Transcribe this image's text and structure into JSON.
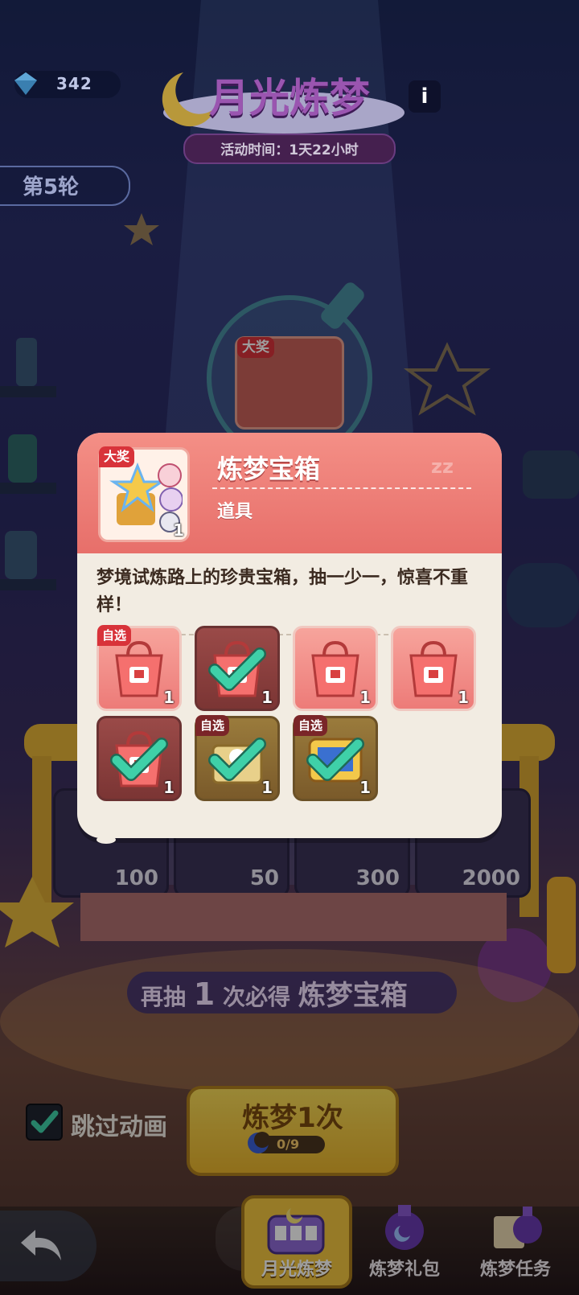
{
  "header": {
    "gem_count": "342",
    "title": "月光炼梦",
    "activity_time": "活动时间：1天22小时",
    "info_icon": "i",
    "round": "第5轮"
  },
  "board": {
    "prize_tag": "大奖",
    "reward_values": [
      "100",
      "50",
      "300",
      "2000"
    ],
    "hint_pre": "再抽",
    "hint_count": "1",
    "hint_mid": "次必得",
    "hint_item": "炼梦宝箱"
  },
  "controls": {
    "skip_label": "跳过动画",
    "skip_checked": true,
    "draw_button": "炼梦1次",
    "draw_count": "0/9"
  },
  "modal": {
    "prize_badge": "大奖",
    "item_name": "炼梦宝箱",
    "item_type": "道具",
    "item_count": "1",
    "description": "梦境试炼路上的珍贵宝箱，抽一少一，惊喜不重样！",
    "rewards": [
      {
        "badge": "自选",
        "count": "1",
        "obtained": false,
        "style": "pink",
        "icon": "gift-bag-icon"
      },
      {
        "badge": "",
        "count": "1",
        "obtained": true,
        "style": "dark",
        "icon": "gift-bag-icon"
      },
      {
        "badge": "",
        "count": "1",
        "obtained": false,
        "style": "pink",
        "icon": "gift-bag-icon"
      },
      {
        "badge": "",
        "count": "1",
        "obtained": false,
        "style": "pink",
        "icon": "gift-bag-icon"
      },
      {
        "badge": "",
        "count": "1",
        "obtained": true,
        "style": "dark",
        "icon": "gift-bag-icon"
      },
      {
        "badge": "自选",
        "count": "1",
        "obtained": true,
        "style": "gold",
        "icon": "gift-box-icon"
      },
      {
        "badge": "自选",
        "count": "1",
        "obtained": true,
        "style": "gold",
        "icon": "tv-box-icon"
      }
    ]
  },
  "nav": {
    "tabs": [
      {
        "label": "月光炼梦",
        "active": true,
        "icon": "slot-machine-icon"
      },
      {
        "label": "炼梦礼包",
        "active": false,
        "icon": "potion-bag-icon"
      },
      {
        "label": "炼梦任务",
        "active": false,
        "icon": "scroll-potion-icon"
      }
    ]
  },
  "colors": {
    "modal_header": "#ef7f79",
    "check": "#3fd0a8",
    "badge_red": "#d8333a",
    "button_gold": "#f2c640"
  }
}
